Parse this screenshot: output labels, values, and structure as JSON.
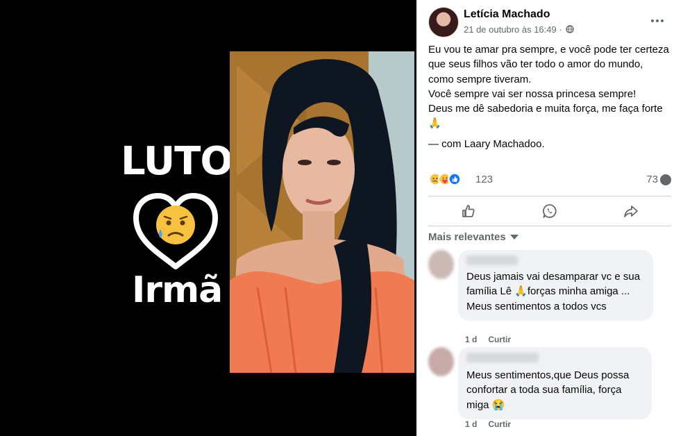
{
  "photo": {
    "luto_label": "LUTO",
    "irma_label": "Irmã"
  },
  "post": {
    "author": "Letícia Machado",
    "timestamp": "21 de outubro às 16:49 ·",
    "privacy_icon": "globe-icon",
    "body_lines": [
      "Eu vou te amar pra sempre, e você pode ter certeza que seus filhos vão ter todo o amor do mundo, como sempre tiveram.",
      "Você sempre vai ser nossa princesa sempre!",
      "Deus me dê sabedoria e muita força, me faça forte 🙏"
    ],
    "tag_prefix": "— com",
    "tag_name": "Laary Machadoo",
    "tag_suffix": ".",
    "reaction_count": "123",
    "comment_count": "73",
    "reaction_icons": [
      "sad-icon",
      "care-icon",
      "like-icon"
    ],
    "actions": [
      "like-icon",
      "whatsapp-icon",
      "share-icon"
    ]
  },
  "comments_sort": "Mais relevantes",
  "comments": [
    {
      "text": "Deus jamais vai desamparar vc e sua família Lê 🙏forças minha amiga ... Meus sentimentos a todos vcs",
      "age": "1 d",
      "reply": "Curtir"
    },
    {
      "text": "Meus sentimentos,que Deus possa confortar a toda sua família, força miga 😭",
      "age": "1 d",
      "reply": "Curtir"
    }
  ],
  "colors": {
    "facebook_blue": "#1877f2",
    "secondary_text": "#65676b",
    "bubble_bg": "#f0f2f5",
    "emoji_yellow": "#f7c23f"
  }
}
